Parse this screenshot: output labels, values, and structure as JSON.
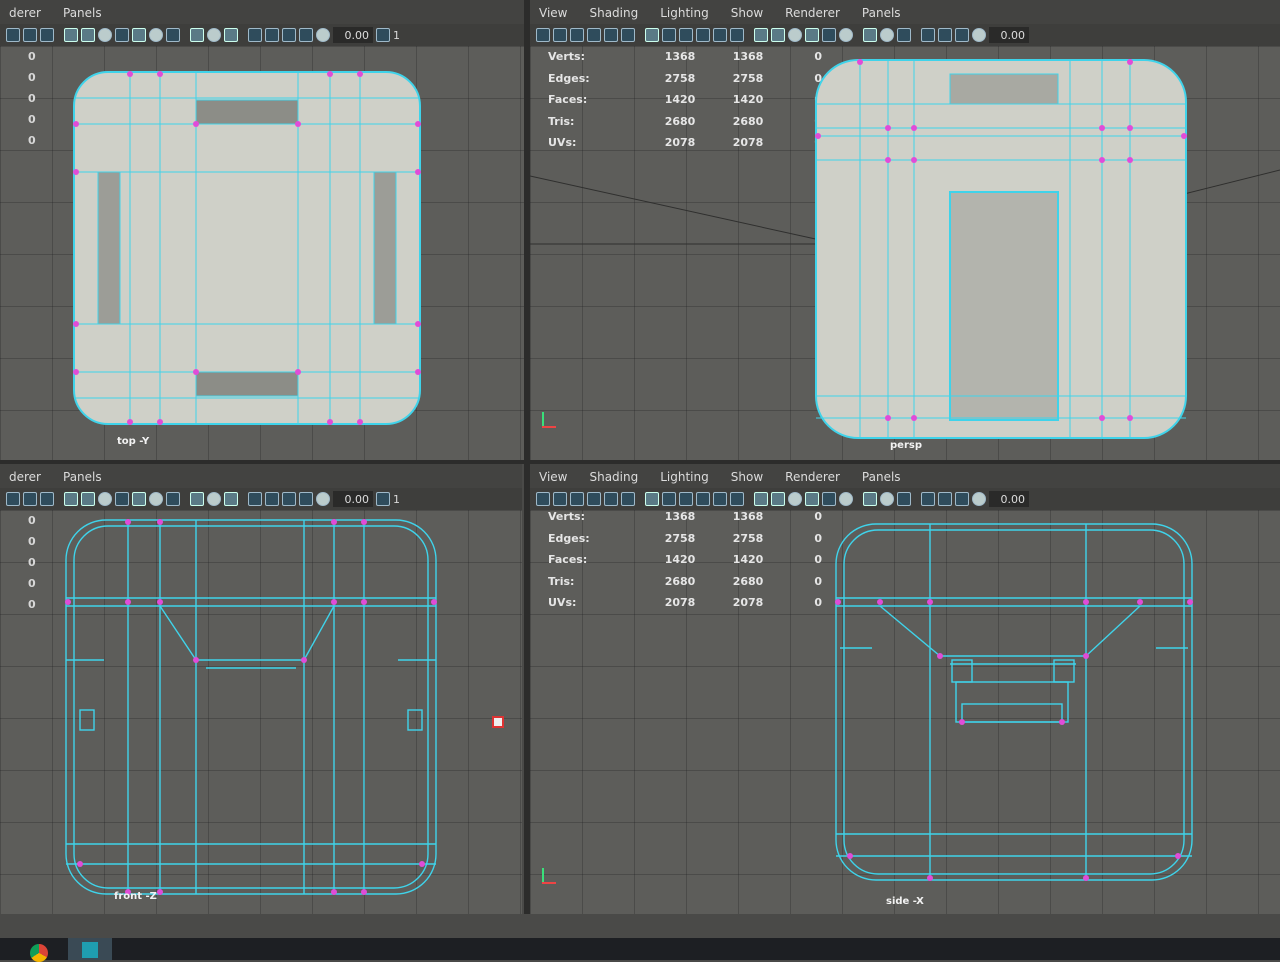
{
  "menus_left": [
    "derer",
    "Panels"
  ],
  "menus_right": [
    "View",
    "Shading",
    "Lighting",
    "Show",
    "Renderer",
    "Panels"
  ],
  "toolbar": {
    "field_value": "0.00",
    "frame_value": "1"
  },
  "stats": {
    "rows": [
      {
        "label": "Verts:",
        "a": "1368",
        "b": "1368",
        "c": "0"
      },
      {
        "label": "Edges:",
        "a": "2758",
        "b": "2758",
        "c": "0"
      },
      {
        "label": "Faces:",
        "a": "1420",
        "b": "1420",
        "c": "0"
      },
      {
        "label": "Tris:",
        "a": "2680",
        "b": "2680",
        "c": "0"
      },
      {
        "label": "UVs:",
        "a": "2078",
        "b": "2078",
        "c": "0"
      }
    ]
  },
  "left_zeros": [
    "0",
    "0",
    "0",
    "0",
    "0"
  ],
  "viewports": {
    "top": "top -Y",
    "persp": "persp",
    "front": "front -Z",
    "side": "side -X"
  },
  "colors": {
    "wire": "#3fd3ea",
    "vertex": "#e04cd8",
    "shaded": "#cfd0c8",
    "axis_y": "#39e07a",
    "axis_x": "#e44444"
  }
}
